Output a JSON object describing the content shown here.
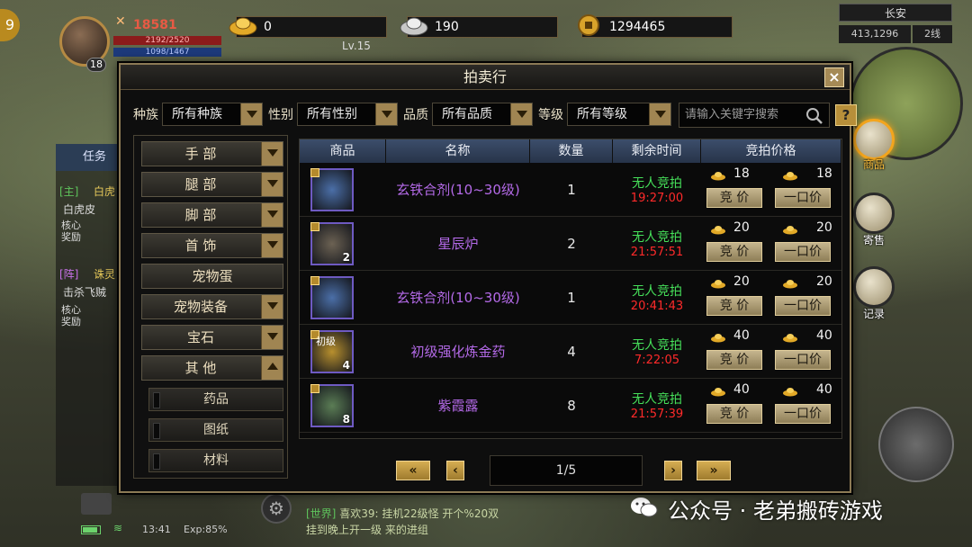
{
  "hud": {
    "power": "18581",
    "hp": "2192/2520",
    "mp": "1098/1467",
    "level_badge": "18",
    "vip_level": "Lv.15",
    "gold_ingot": "0",
    "silver_ingot": "190",
    "coins": "1294465",
    "map_name": "长安",
    "map_coords": "413,1296",
    "map_line": "2线",
    "left_chip": "9"
  },
  "side_buttons": {
    "shop": "商品",
    "consign": "寄售",
    "record": "记录"
  },
  "quests": {
    "tab": "任务",
    "q1_tag": "[主]",
    "q1_title": "白虎",
    "q1_desc": "白虎皮",
    "q1_reward": "核心\n奖励",
    "q2_tag": "[阵]",
    "q2_title": "诛灵",
    "q2_desc": "击杀飞贼",
    "q2_reward": "核心\n奖励"
  },
  "chat": {
    "line1_tag": "[世界]",
    "line1_text": "喜欢39: 挂机22级怪 开个%20双",
    "line2_text": "挂到晚上开一级 来的进组"
  },
  "status": {
    "time": "13:41",
    "exp": "Exp:85%"
  },
  "watermark": "公众号 · 老弟搬砖游戏",
  "dialog": {
    "title": "拍卖行",
    "close": "×",
    "filters": {
      "race_label": "种族",
      "race_value": "所有种族",
      "gender_label": "性别",
      "gender_value": "所有性别",
      "quality_label": "品质",
      "quality_value": "所有品质",
      "level_label": "等级",
      "level_value": "所有等级",
      "search_placeholder": "请输入关键字搜索",
      "help": "?"
    },
    "categories": [
      "手 部",
      "腿 部",
      "脚 部",
      "首 饰",
      "宠物蛋",
      "宠物装备",
      "宝石",
      "其 他"
    ],
    "subcategories": [
      "药品",
      "图纸",
      "材料"
    ],
    "columns": [
      "商品",
      "名称",
      "数量",
      "剩余时间",
      "竞拍价格"
    ],
    "rows": [
      {
        "name": "玄铁合剂(10~30级)",
        "qty": "1",
        "icon_qty": "",
        "status": "无人竞拍",
        "time": "19:27:00",
        "bid": "18",
        "buyout": "18"
      },
      {
        "name": "星辰炉",
        "qty": "2",
        "icon_qty": "2",
        "status": "无人竞拍",
        "time": "21:57:51",
        "bid": "20",
        "buyout": "20"
      },
      {
        "name": "玄铁合剂(10~30级)",
        "qty": "1",
        "icon_qty": "",
        "status": "无人竞拍",
        "time": "20:41:43",
        "bid": "20",
        "buyout": "20"
      },
      {
        "name": "初级强化炼金药",
        "qty": "4",
        "icon_qty": "4",
        "icon_label": "初级",
        "status": "无人竞拍",
        "time": "7:22:05",
        "bid": "40",
        "buyout": "40"
      },
      {
        "name": "紫霞露",
        "qty": "8",
        "icon_qty": "8",
        "status": "无人竞拍",
        "time": "21:57:39",
        "bid": "40",
        "buyout": "40"
      }
    ],
    "bid_label": "竞 价",
    "buyout_label": "一口价",
    "page": "1/5",
    "first": "«",
    "prev": "‹",
    "next": "›",
    "last": "»"
  },
  "colors": {
    "item_name": "#b46ae8",
    "no_bid": "#46e05a",
    "time_left": "#ff2a2a"
  }
}
